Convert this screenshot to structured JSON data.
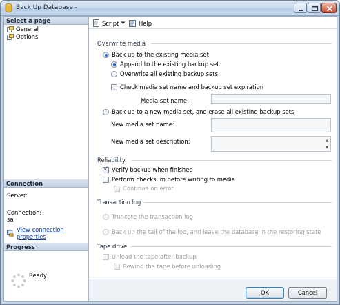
{
  "window": {
    "title": "Back Up Database -"
  },
  "left": {
    "select_page": "Select a page",
    "pages": [
      {
        "label": "General"
      },
      {
        "label": "Options"
      }
    ],
    "connection_header": "Connection",
    "server_label": "Server:",
    "connection_label": "Connection:",
    "connection_value": "sa",
    "view_props_link": "View connection properties",
    "progress_header": "Progress",
    "progress_status": "Ready"
  },
  "toolbar": {
    "script_label": "Script",
    "help_label": "Help"
  },
  "overwrite": {
    "header": "Overwrite media",
    "existing": "Back up to the existing media set",
    "append": "Append to the existing backup set",
    "overwrite_all": "Overwrite all existing backup sets",
    "check_media": "Check media set name and backup set expiration",
    "media_set_name": "Media set name:",
    "new_media": "Back up to a new media set, and erase all existing backup sets",
    "new_media_name": "New media set name:",
    "new_media_desc": "New media set description:"
  },
  "reliability": {
    "header": "Reliability",
    "verify": "Verify backup when finished",
    "checksum": "Perform checksum before writing to media",
    "continue": "Continue on error"
  },
  "translog": {
    "header": "Transaction log",
    "truncate": "Truncate the transaction log",
    "tail": "Back up the tail of the log, and leave the database in the restoring state"
  },
  "tape": {
    "header": "Tape drive",
    "unload": "Unload the tape after backup",
    "rewind": "Rewind the tape before unloading"
  },
  "buttons": {
    "ok": "OK",
    "cancel": "Cancel"
  }
}
